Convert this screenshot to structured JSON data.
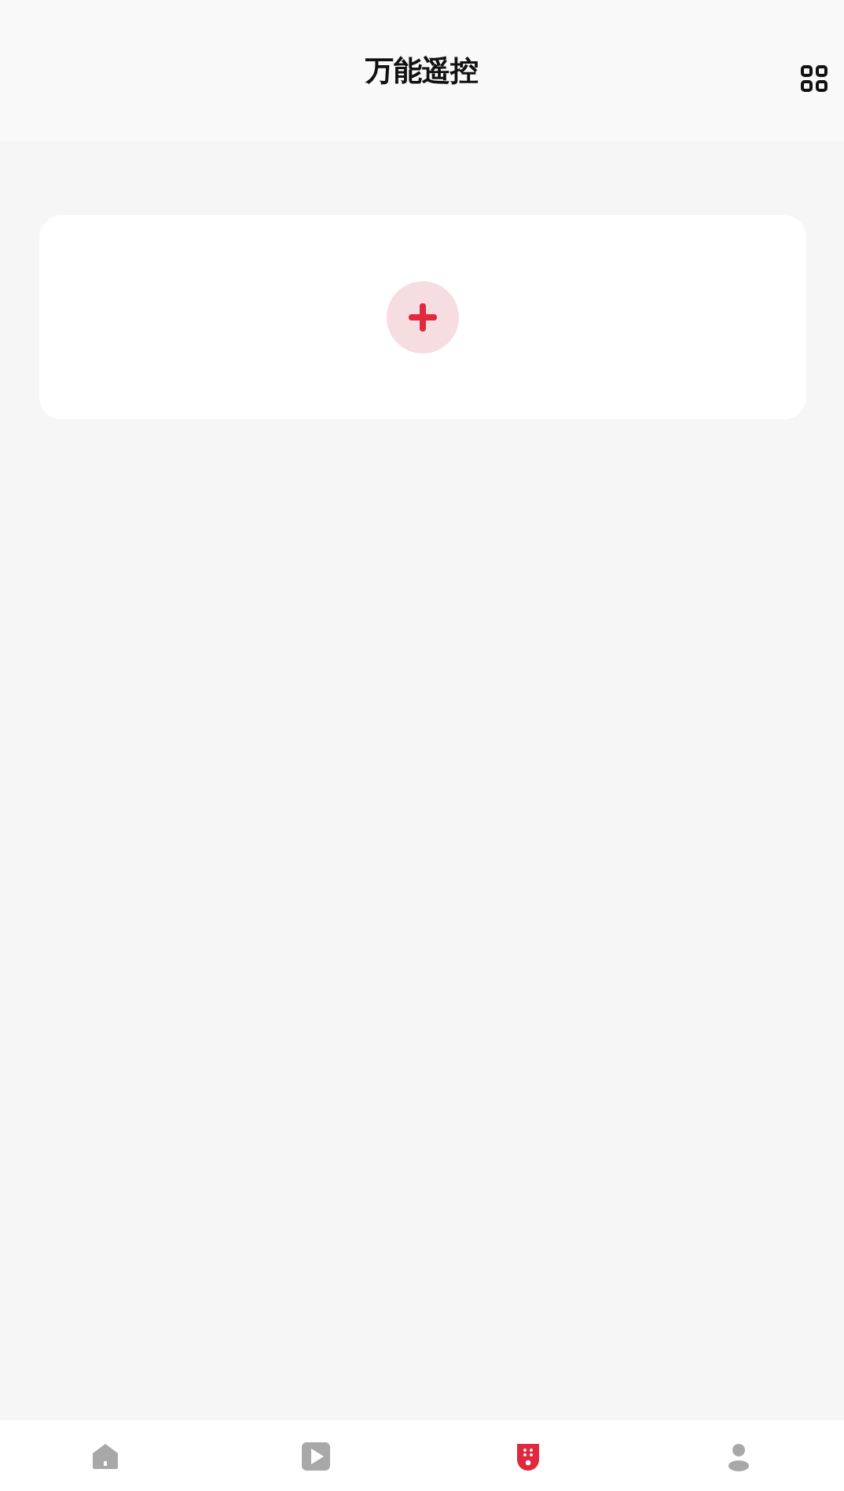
{
  "header": {
    "title": "万能遥控"
  },
  "tabs": [
    {
      "kind": "home",
      "selected": false
    },
    {
      "kind": "video",
      "selected": false
    },
    {
      "kind": "remote",
      "selected": true
    },
    {
      "kind": "profile",
      "selected": false
    }
  ]
}
